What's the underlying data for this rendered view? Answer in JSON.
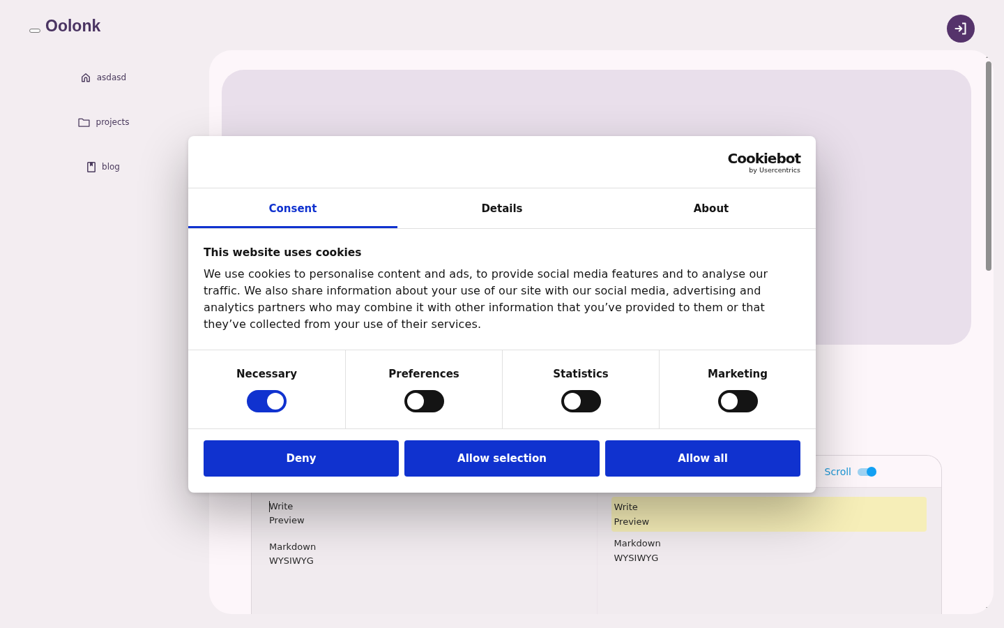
{
  "sidebar": {
    "logo": "Oolonk",
    "items": [
      {
        "label": "asdasd"
      },
      {
        "label": "projects"
      },
      {
        "label": "blog"
      }
    ]
  },
  "editor": {
    "scroll_toggle": {
      "label": "Scroll",
      "on": true
    },
    "panes": [
      {
        "kind": "source",
        "focused": true,
        "paragraphs": [
          {
            "lines": [
              "Write",
              "Preview"
            ],
            "highlighted": false
          },
          {
            "lines": [
              "Markdown",
              "WYSIWYG"
            ],
            "highlighted": false
          }
        ]
      },
      {
        "kind": "preview",
        "focused": false,
        "paragraphs": [
          {
            "lines": [
              "Write",
              "Preview"
            ],
            "highlighted": true
          },
          {
            "lines": [
              "Markdown",
              "WYSIWYG"
            ],
            "highlighted": false
          }
        ]
      }
    ]
  },
  "cookie_dialog": {
    "brand": {
      "name": "Cookiebot",
      "byline": "by Usercentrics"
    },
    "tabs": [
      {
        "label": "Consent",
        "selected": true
      },
      {
        "label": "Details",
        "selected": false
      },
      {
        "label": "About",
        "selected": false
      }
    ],
    "heading": "This website uses cookies",
    "body": "We use cookies to personalise content and ads, to provide social media features and to analyse our traffic. We also share information about your use of our site with our social media, advertising and analytics partners who may combine it with other information that you’ve provided to them or that they’ve collected from your use of their services.",
    "categories": [
      {
        "label": "Necessary",
        "on": true
      },
      {
        "label": "Preferences",
        "on": false
      },
      {
        "label": "Statistics",
        "on": false
      },
      {
        "label": "Marketing",
        "on": false
      }
    ],
    "buttons": [
      "Deny",
      "Allow selection",
      "Allow all"
    ]
  }
}
